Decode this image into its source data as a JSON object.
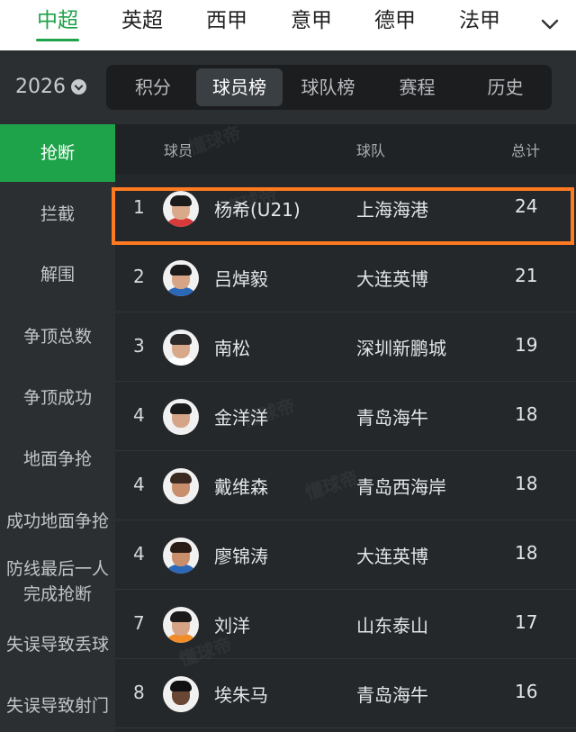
{
  "league_tabs": [
    "中超",
    "英超",
    "西甲",
    "意甲",
    "德甲",
    "法甲"
  ],
  "active_league": "中超",
  "season": "2026",
  "segment_tabs": [
    "积分",
    "球员榜",
    "球队榜",
    "赛程",
    "历史"
  ],
  "active_segment": "球员榜",
  "categories": [
    "抢断",
    "拦截",
    "解围",
    "争顶总数",
    "争顶成功",
    "地面争抢",
    "成功地面争抢",
    "防线最后一人\n完成抢断",
    "失误导致丢球",
    "失误导致射门"
  ],
  "active_category": "抢断",
  "table": {
    "headers": {
      "player": "球员",
      "team": "球队",
      "total": "总计"
    },
    "rows": [
      {
        "rank": "1",
        "player": "杨希(U21)",
        "team": "上海海港",
        "total": "24",
        "highlighted": true
      },
      {
        "rank": "2",
        "player": "吕焯毅",
        "team": "大连英博",
        "total": "21"
      },
      {
        "rank": "3",
        "player": "南松",
        "team": "深圳新鹏城",
        "total": "19"
      },
      {
        "rank": "4",
        "player": "金洋洋",
        "team": "青岛海牛",
        "total": "18"
      },
      {
        "rank": "4",
        "player": "戴维森",
        "team": "青岛西海岸",
        "total": "18"
      },
      {
        "rank": "4",
        "player": "廖锦涛",
        "team": "大连英博",
        "total": "18"
      },
      {
        "rank": "7",
        "player": "刘洋",
        "team": "山东泰山",
        "total": "17"
      },
      {
        "rank": "8",
        "player": "埃朱马",
        "team": "青岛海牛",
        "total": "16"
      }
    ]
  },
  "colors": {
    "accent": "#1fa34a",
    "highlight": "#ff7a21"
  }
}
